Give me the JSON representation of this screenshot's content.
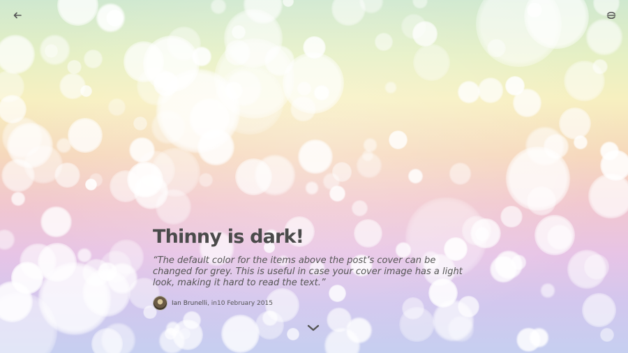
{
  "nav": {
    "back_icon": "arrow-left-icon",
    "menu_icon": "menu-toggle-icon"
  },
  "post": {
    "title": "Thinny is dark!",
    "excerpt": "“The default color for the items above the post’s cover can be changed for grey. This is useful in case your cover image has a light look, making it hard to read the text.”",
    "author": "Ian Brunelli",
    "date_prefix": ", in ",
    "date": "10 February 2015"
  },
  "scroll": {
    "icon": "chevron-down-icon"
  },
  "colors": {
    "text": "#4a4a4a",
    "icon": "#555555"
  }
}
